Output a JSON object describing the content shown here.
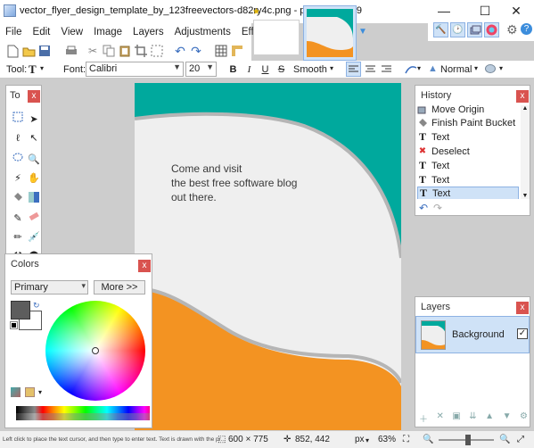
{
  "window": {
    "title": "vector_flyer_design_template_by_123freevectors-d82ry4c.png - paint.net 4.0.9",
    "minimize": "—",
    "maximize": "☐",
    "close": "✕"
  },
  "menu": {
    "items": [
      "File",
      "Edit",
      "View",
      "Image",
      "Layers",
      "Adjustments",
      "Effects"
    ]
  },
  "tool_options": {
    "tool_label": "Tool:",
    "tool_glyph": "T",
    "font_label": "Font:",
    "font_value": "Calibri",
    "size_value": "20",
    "bold": "B",
    "italic": "I",
    "underline": "U",
    "strikethrough": "S",
    "antialias": "Smooth",
    "blend_mode": "Normal"
  },
  "canvas_text": {
    "line1": "Come and visit",
    "line2": "the best free software blog",
    "line3": "out there."
  },
  "tools_panel": {
    "title": "To",
    "close": "x"
  },
  "colors_panel": {
    "title": "Colors",
    "close": "x",
    "primary_select": "Primary",
    "more_button": "More >>"
  },
  "history_panel": {
    "title": "History",
    "close": "x",
    "items": [
      "Move Origin",
      "Finish Paint Bucket",
      "Text",
      "Deselect",
      "Text",
      "Text",
      "Text"
    ]
  },
  "layers_panel": {
    "title": "Layers",
    "close": "x",
    "layer_name": "Background"
  },
  "status": {
    "hint": "Left click to place the text cursor, and then type to enter text. Text is drawn with the pr...",
    "image_size": "600 × 775",
    "cursor_pos": "852, 442",
    "units": "px",
    "zoom": "63%"
  },
  "colors": {
    "teal": "#00a99d",
    "orange": "#f39322",
    "accent": "#3c8ddc"
  }
}
